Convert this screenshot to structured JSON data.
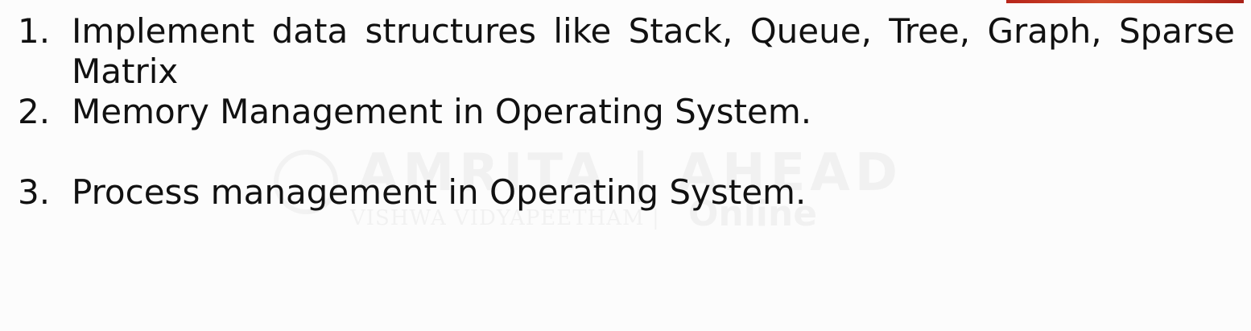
{
  "watermark": {
    "main": "AMRITA | AHEAD",
    "sub": "VISHWA VIDYAPEETHAM |",
    "online": "Online"
  },
  "list": {
    "items": [
      {
        "number": "1.",
        "text": "Implement data structures like Stack, Queue, Tree, Graph, Sparse Matrix"
      },
      {
        "number": "2.",
        "text": "Memory Management in Operating System."
      },
      {
        "number": "3.",
        "text": "Process management in Operating System."
      }
    ]
  }
}
